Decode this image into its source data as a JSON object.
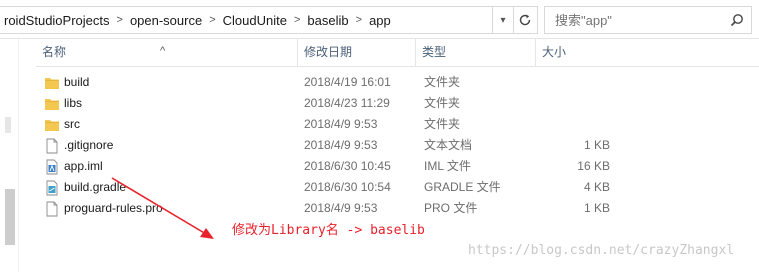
{
  "address": {
    "crumbs": [
      "roidStudioProjects",
      "open-source",
      "CloudUnite",
      "baselib",
      "app"
    ],
    "separator": ">"
  },
  "search": {
    "placeholder": "搜索\"app\""
  },
  "columns": {
    "name": "名称",
    "date": "修改日期",
    "type": "类型",
    "size": "大小"
  },
  "files": [
    {
      "icon": "folder-icon",
      "name": "build",
      "date": "2018/4/19 16:01",
      "type": "文件夹",
      "size": ""
    },
    {
      "icon": "folder-icon",
      "name": "libs",
      "date": "2018/4/23 11:29",
      "type": "文件夹",
      "size": ""
    },
    {
      "icon": "folder-icon",
      "name": "src",
      "date": "2018/4/9 9:53",
      "type": "文件夹",
      "size": ""
    },
    {
      "icon": "file-icon",
      "name": ".gitignore",
      "date": "2018/4/9 9:53",
      "type": "文本文档",
      "size": "1 KB"
    },
    {
      "icon": "iml-file-icon",
      "name": "app.iml",
      "date": "2018/6/30 10:45",
      "type": "IML 文件",
      "size": "16 KB"
    },
    {
      "icon": "gradle-file-icon",
      "name": "build.gradle",
      "date": "2018/6/30 10:54",
      "type": "GRADLE 文件",
      "size": "4 KB"
    },
    {
      "icon": "file-icon",
      "name": "proguard-rules.pro",
      "date": "2018/4/9 9:53",
      "type": "PRO 文件",
      "size": "1 KB"
    }
  ],
  "annotation": {
    "text": "修改为Library名 -> baselib",
    "color": "#e8212a"
  },
  "watermark": "https://blog.csdn.net/crazyZhangxl",
  "colors": {
    "folder": "#f3c851",
    "header_text": "#4c607a",
    "secondary_text": "#6d6d6d"
  }
}
